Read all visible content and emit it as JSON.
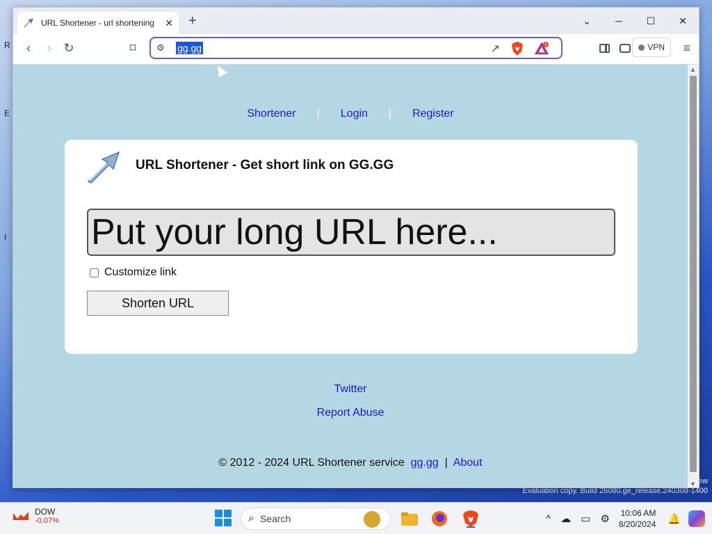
{
  "desktop": {
    "fragments": [
      "R",
      "E",
      "I"
    ],
    "watermark": "Evaluation copy. Build 26080.ge_release.240308-1400",
    "watermark_tail": "ew"
  },
  "browser": {
    "tab": {
      "title": "URL Shortener - url shortening",
      "close": "✕"
    },
    "new_tab": "+",
    "window_controls": {
      "dropdown": "⌄",
      "minimize": "─",
      "maximize": "☐",
      "close": "✕"
    },
    "nav": {
      "back": "‹",
      "forward": "›",
      "reload": "↻",
      "bookmark": "⌑"
    },
    "address_bar": {
      "url": "gg.gg",
      "settings": "⚙"
    },
    "rewards_badge": "3",
    "vpn_label": "VPN",
    "menu": "≡"
  },
  "page": {
    "nav": {
      "shortener": "Shortener",
      "sep": "|",
      "login": "Login",
      "register": "Register"
    },
    "card": {
      "title": "URL Shortener - Get short link on GG.GG",
      "url_input_placeholder": "Put your long URL here...",
      "customize_label": "Customize link",
      "shorten_button": "Shorten URL"
    },
    "footer": {
      "twitter": "Twitter",
      "report_abuse": "Report Abuse",
      "copyright": "© 2012 - 2024 URL Shortener service",
      "link_site": "gg.gg",
      "sep": "|",
      "link_about": "About"
    }
  },
  "taskbar": {
    "stock": {
      "name": "DOW",
      "change": "-0.07%"
    },
    "search_placeholder": "Search",
    "tray": {
      "chevron": "^",
      "time": "10:06 AM",
      "date": "8/20/2024"
    }
  },
  "colors": {
    "page_bg": "#b5d7e4",
    "link": "#1a1acc",
    "accent_omnibox": "#6a5acd"
  }
}
